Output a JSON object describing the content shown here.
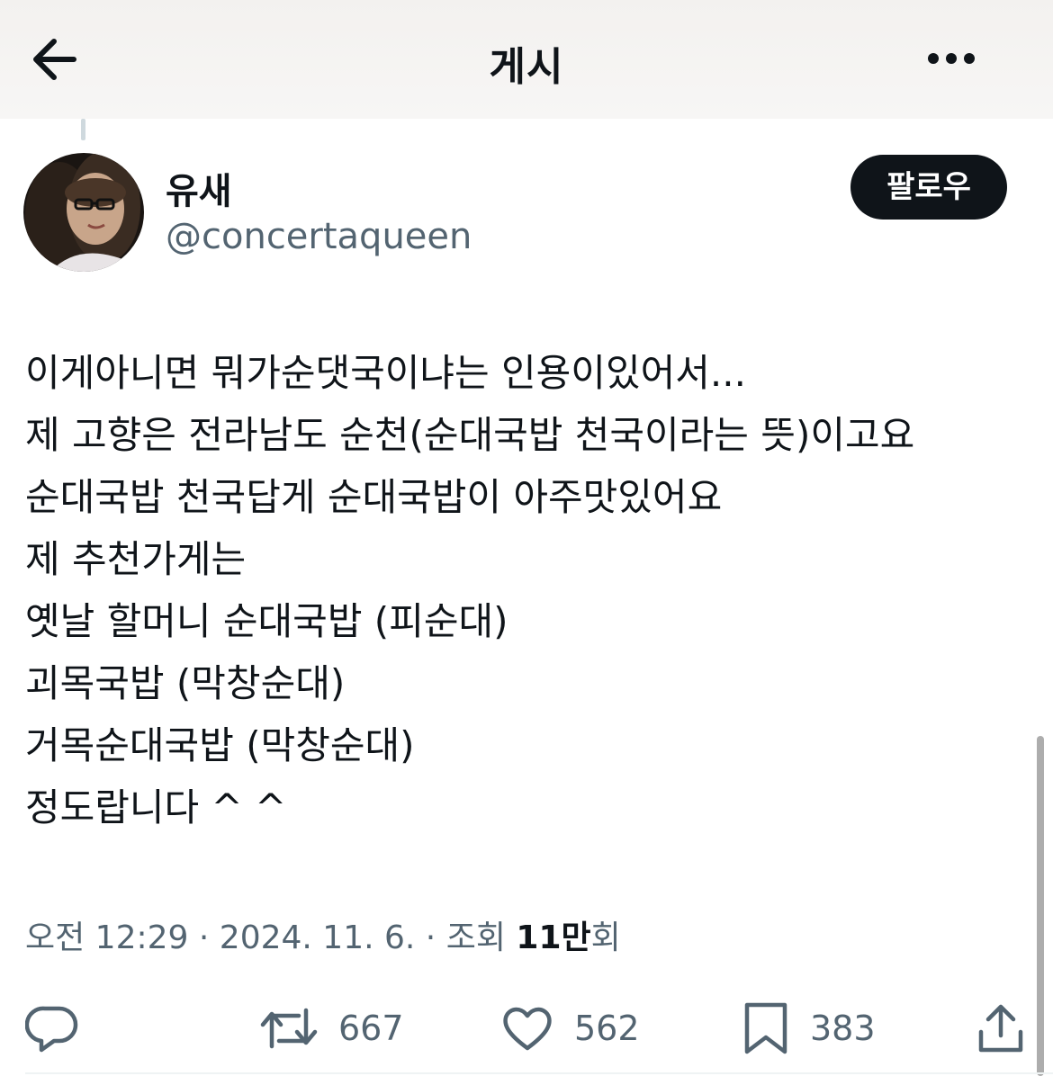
{
  "header": {
    "title": "게시",
    "back_icon": "arrow-left-icon",
    "more_icon": "ellipsis-icon"
  },
  "author": {
    "display_name": "유새",
    "handle": "@concertaqueen",
    "follow_label": "팔로우"
  },
  "tweet": {
    "lines": [
      "이게아니면 뭐가순댓국이냐는 인용이있어서...",
      "제 고향은 전라남도 순천(순대국밥 천국이라는 뜻)이고요",
      "순대국밥 천국답게 순대국밥이 아주맛있어요",
      "제 추천가게는",
      "옛날 할머니 순대국밥 (피순대)",
      "괴목국밥 (막창순대)",
      "거목순대국밥 (막창순대)",
      "정도랍니다 ^ ^"
    ]
  },
  "meta": {
    "time": "오전 12:29",
    "separator": "·",
    "date": "2024. 11. 6.",
    "views_label": "조회",
    "views_count": "11만",
    "views_suffix": "회"
  },
  "actions": {
    "reply_icon": "reply-icon",
    "retweet_icon": "retweet-icon",
    "retweets": "667",
    "like_icon": "heart-icon",
    "likes": "562",
    "bookmark_icon": "bookmark-icon",
    "bookmarks": "383",
    "share_icon": "share-icon"
  },
  "colors": {
    "text": "#0f1419",
    "secondary": "#536471",
    "follow_bg": "#0f1419",
    "header_bg": "#f3f1ef"
  }
}
